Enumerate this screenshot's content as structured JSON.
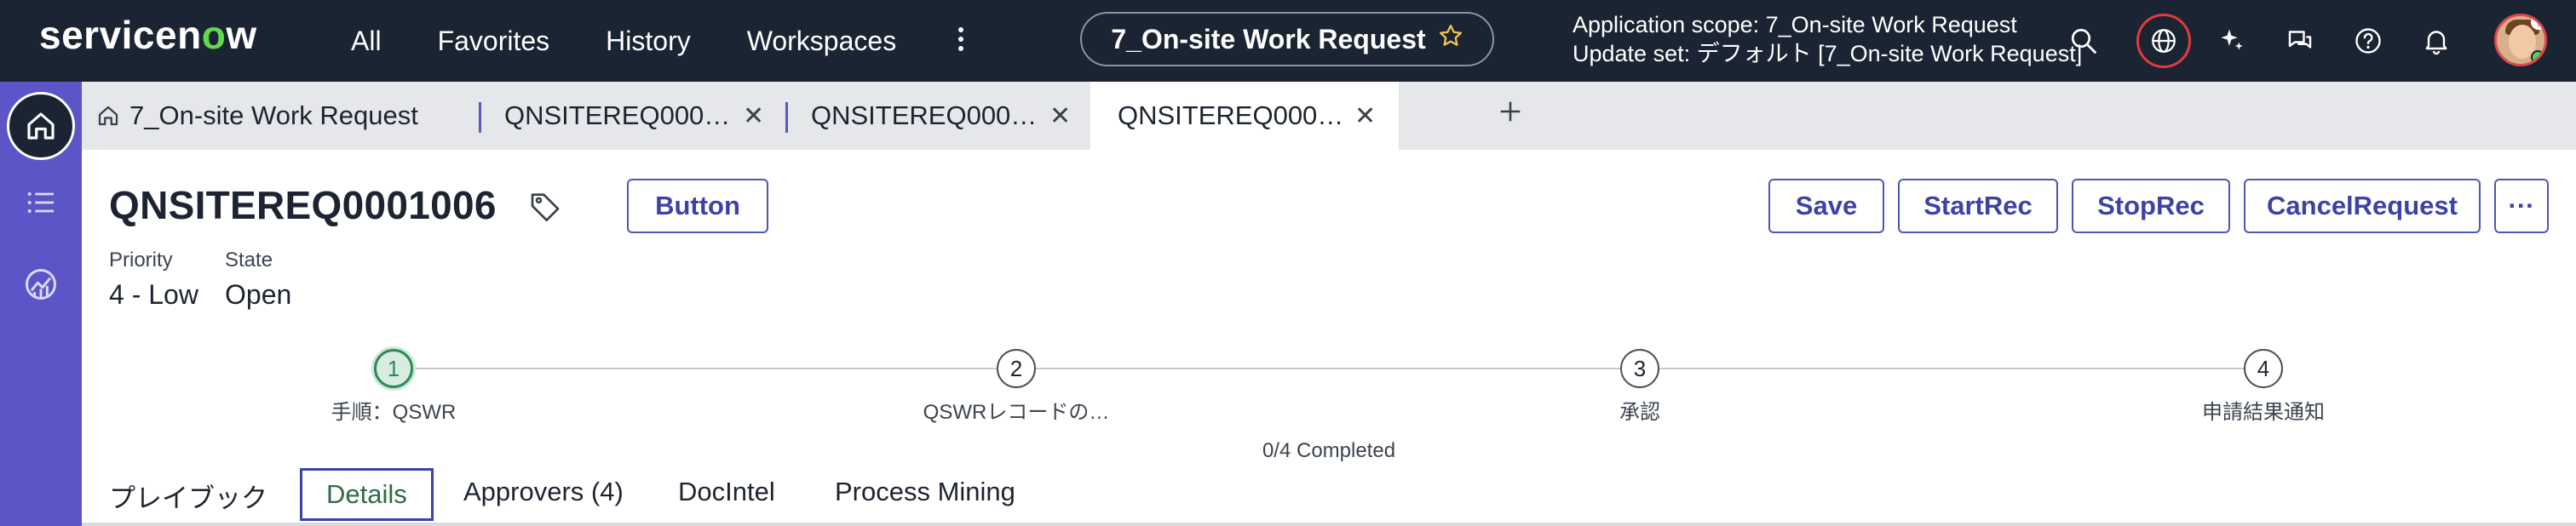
{
  "header": {
    "logo": {
      "pre": "servicen",
      "o": "o",
      "post": "w"
    },
    "nav": [
      "All",
      "Favorites",
      "History",
      "Workspaces"
    ],
    "context_title": "7_On-site Work Request",
    "scope_line1": "Application scope: 7_On-site Work Request",
    "scope_line2": "Update set: デフォルト [7_On-site Work Request]"
  },
  "tabs": [
    {
      "label": "7_On-site Work Request",
      "icon": "home-icon"
    },
    {
      "label": "QNSITEREQ000…"
    },
    {
      "label": "QNSITEREQ000…"
    },
    {
      "label": "QNSITEREQ000…",
      "active": true
    }
  ],
  "record": {
    "number": "QNSITEREQ0001006",
    "inline_button": "Button",
    "actions": [
      "Save",
      "StartRec",
      "StopRec",
      "CancelRequest"
    ],
    "more_label": "···",
    "fields": [
      {
        "label": "Priority",
        "value": "4 - Low"
      },
      {
        "label": "State",
        "value": "Open"
      }
    ]
  },
  "stepper": {
    "steps": [
      {
        "num": "1",
        "label": "手順：QSWR",
        "current": true
      },
      {
        "num": "2",
        "label": "QSWRレコードの…"
      },
      {
        "num": "3",
        "label": "承認"
      },
      {
        "num": "4",
        "label": "申請結果通知"
      }
    ],
    "summary": "0/4 Completed"
  },
  "form_tabs": [
    "プレイブック",
    "Details",
    "Approvers (4)",
    "DocIntel",
    "Process Mining"
  ],
  "colors": {
    "header_bg": "#1b2433",
    "rail_bg": "#5b55c7",
    "accent": "#3c43a4",
    "step_current": "#2e8a59",
    "logo_o": "#62d84e"
  }
}
